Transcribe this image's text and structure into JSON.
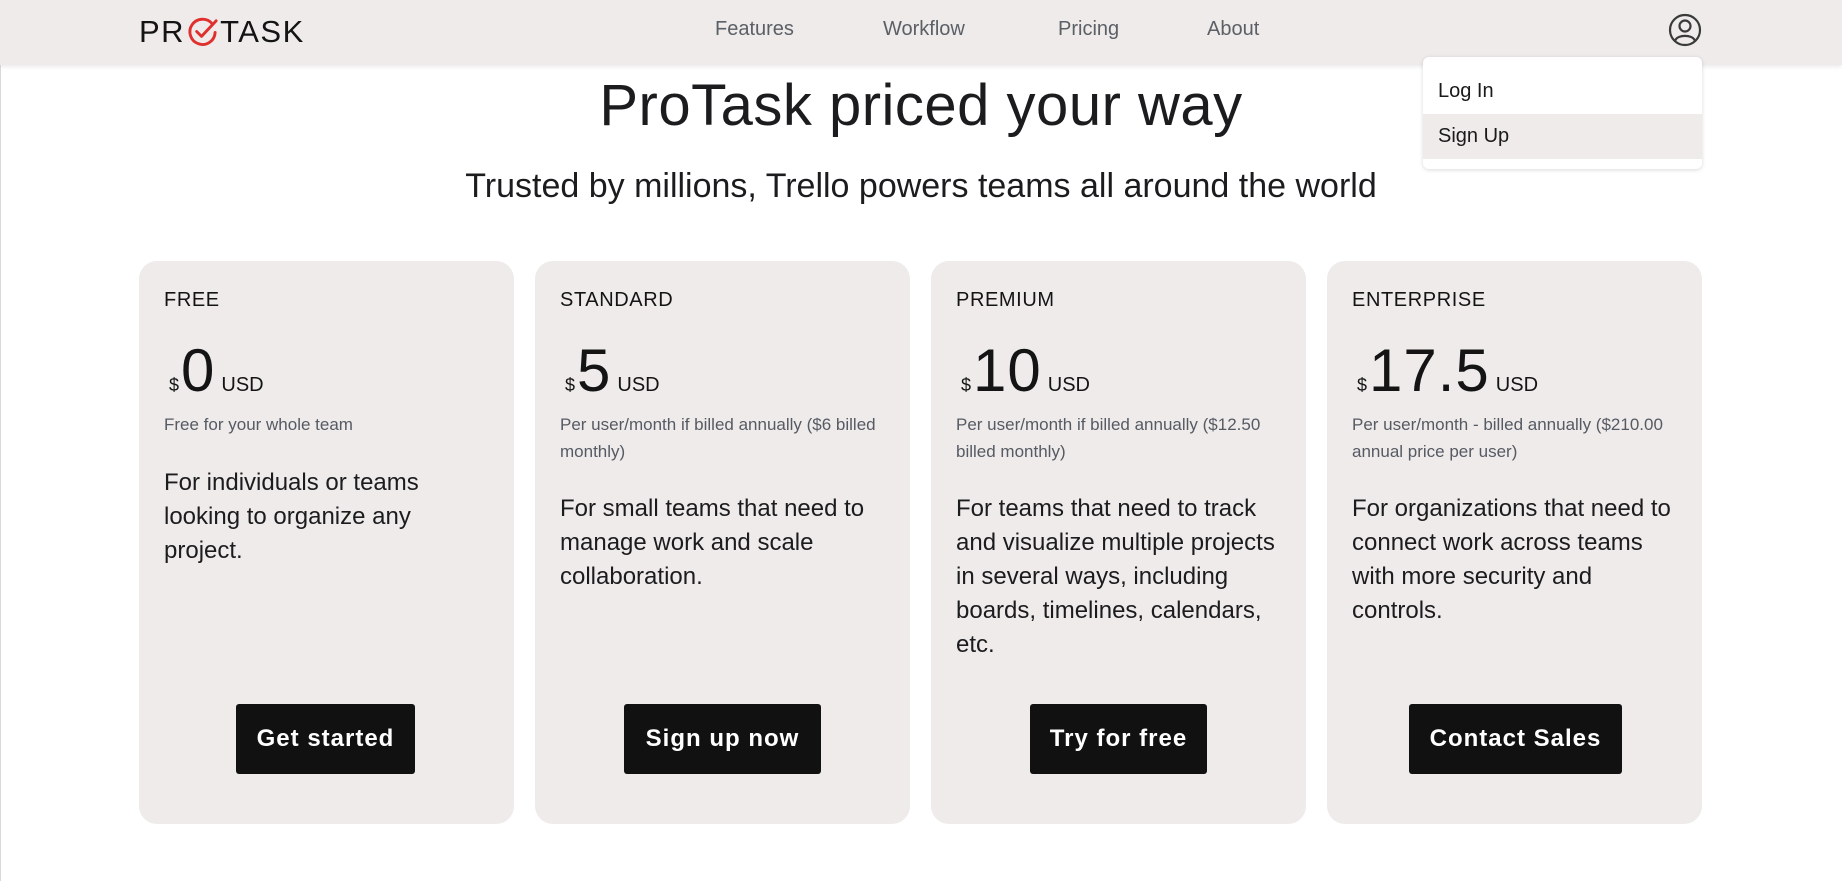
{
  "brand": {
    "logo_left": "PR",
    "logo_right": "TASK",
    "accent_color": "#e0302e"
  },
  "nav": {
    "links": [
      "Features",
      "Workflow",
      "Pricing",
      "About"
    ],
    "account_icon": "user-circle-icon"
  },
  "account_menu": {
    "items": [
      "Log In",
      "Sign Up"
    ],
    "highlighted_item": "Sign Up"
  },
  "hero": {
    "title": "ProTask priced your way",
    "subtitle": "Trusted by millions, Trello powers teams all around the world"
  },
  "plans": [
    {
      "tier": "FREE",
      "currency": "$",
      "amount": "0",
      "unit": "USD",
      "billing": "Free for your whole team",
      "description": "For individuals or teams looking to organize any project.",
      "cta": "Get started"
    },
    {
      "tier": "STANDARD",
      "currency": "$",
      "amount": "5",
      "unit": "USD",
      "billing": "Per user/month if billed annually ($6 billed monthly)",
      "description": "For small teams that need to manage work and scale collaboration.",
      "cta": "Sign up now"
    },
    {
      "tier": "PREMIUM",
      "currency": "$",
      "amount": "10",
      "unit": "USD",
      "billing": "Per user/month if billed annually ($12.50 billed monthly)",
      "description": "For teams that need to track and visualize multiple projects in several ways, including boards, timelines, calendars, etc.",
      "cta": "Try for free"
    },
    {
      "tier": "ENTERPRISE",
      "currency": "$",
      "amount": "17.5",
      "unit": "USD",
      "billing": "Per user/month - billed annually ($210.00 annual price per user)",
      "description": "For organizations that need to connect work across teams with more security and controls.",
      "cta": "Contact Sales"
    }
  ],
  "colors": {
    "nav_background": "#eeebea",
    "card_background": "#eeebea",
    "button_background": "#111111",
    "button_text": "#ffffff",
    "muted_text": "#565a63"
  }
}
